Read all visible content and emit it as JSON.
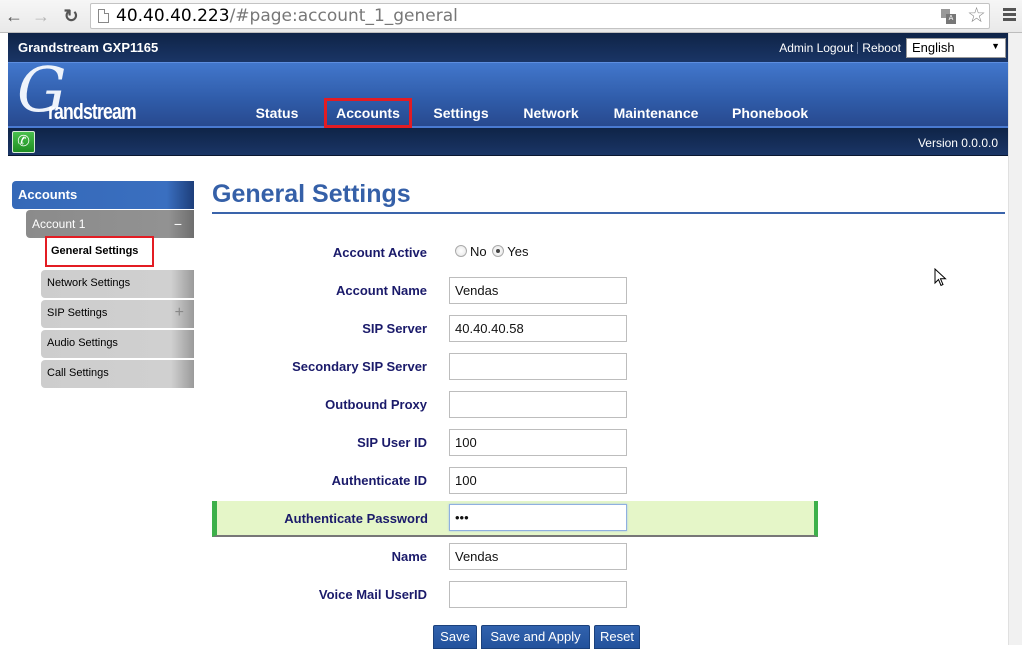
{
  "browser": {
    "url_host": "40.40.40.223",
    "url_path": "/#page:account_1_general",
    "icons": {
      "back": "arrow-left-icon",
      "forward": "arrow-right-icon",
      "reload": "reload-icon",
      "page": "page-icon",
      "translate": "translate-icon",
      "bookmark": "star-icon",
      "menu": "hamburger-menu-icon"
    }
  },
  "topbar": {
    "product_title": "Grandstream GXP1165",
    "admin_logout": "Admin Logout",
    "reboot": "Reboot",
    "language": "English"
  },
  "header": {
    "logo_initial": "G",
    "logo_rest": "randstream",
    "nav": [
      {
        "label": "Status",
        "active": false
      },
      {
        "label": "Accounts",
        "active": true
      },
      {
        "label": "Settings",
        "active": false
      },
      {
        "label": "Network",
        "active": false
      },
      {
        "label": "Maintenance",
        "active": false
      },
      {
        "label": "Phonebook",
        "active": false
      }
    ],
    "version": "Version 0.0.0.0"
  },
  "sidebar": {
    "section": "Accounts",
    "account": "Account 1",
    "account_toggle": "−",
    "items": [
      {
        "label": "General Settings",
        "current": true
      },
      {
        "label": "Network Settings",
        "current": false
      },
      {
        "label": "SIP Settings",
        "current": false,
        "expand": "+"
      },
      {
        "label": "Audio Settings",
        "current": false
      },
      {
        "label": "Call Settings",
        "current": false
      }
    ]
  },
  "main": {
    "title": "General Settings",
    "account_active": {
      "label": "Account Active",
      "options": [
        "No",
        "Yes"
      ],
      "selected": "Yes"
    },
    "fields": [
      {
        "label": "Account Name",
        "value": "Vendas"
      },
      {
        "label": "SIP Server",
        "value": "40.40.40.58"
      },
      {
        "label": "Secondary SIP Server",
        "value": ""
      },
      {
        "label": "Outbound Proxy",
        "value": ""
      },
      {
        "label": "SIP User ID",
        "value": "100"
      },
      {
        "label": "Authenticate ID",
        "value": "100"
      },
      {
        "label": "Authenticate Password",
        "value": "•••",
        "type": "password",
        "focused": true
      },
      {
        "label": "Name",
        "value": "Vendas"
      },
      {
        "label": "Voice Mail UserID",
        "value": ""
      }
    ],
    "buttons": {
      "save": "Save",
      "save_apply": "Save and Apply",
      "reset": "Reset"
    }
  },
  "colors": {
    "accent_blue": "#3560a8",
    "highlight_red": "#e31c23",
    "focus_row": "#e5f6c8",
    "focus_bar": "#3db04a",
    "label_navy": "#1a1a6a"
  }
}
